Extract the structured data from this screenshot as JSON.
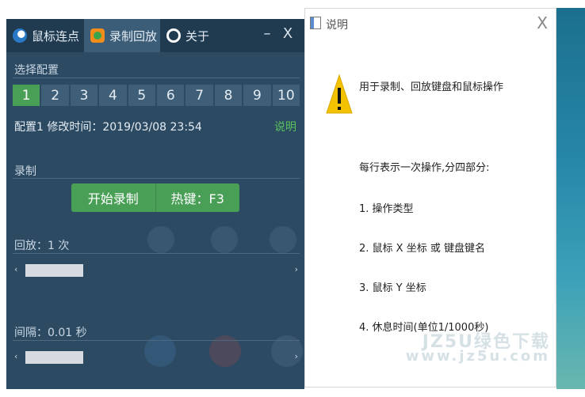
{
  "left_app": {
    "tabs": [
      {
        "label": "鼠标连点",
        "icon": "mouse-icon"
      },
      {
        "label": "录制回放",
        "icon": "record-icon"
      },
      {
        "label": "关于",
        "icon": "about-icon"
      }
    ],
    "minimize_label": "–",
    "close_label": "X",
    "config_section_label": "选择配置",
    "config_buttons": [
      "1",
      "2",
      "3",
      "4",
      "5",
      "6",
      "7",
      "8",
      "9",
      "10"
    ],
    "active_config": "1",
    "info_line": "配置1 修改时间：2019/03/08 23:54",
    "help_link": "说明",
    "record_section_label": "录制",
    "record_button_label": "开始录制",
    "hotkey_label": "热键：F3",
    "playback_label": "回放：1 次",
    "interval_label": "间隔：0.01 秒",
    "slider_left_arrow": "‹",
    "slider_right_arrow": "›",
    "playback_slider_level": 0.22,
    "interval_slider_level": 0.22
  },
  "dialog": {
    "title": "说明",
    "close_label": "X",
    "warning_icon": "warning-icon",
    "line1": "用于录制、回放键盘和鼠标操作",
    "line2": "每行表示一次操作,分四部分:",
    "item1": "1. 操作类型",
    "item2": "2. 鼠标 X 坐标 或 键盘键名",
    "item3": "3. 鼠标 Y 坐标",
    "item4": "4. 休息时间(单位1/1000秒)"
  },
  "watermark": {
    "line1": "JZ5U绿色下载",
    "line2": "www.jz5u.com"
  },
  "colors": {
    "window_bg": "#2d4a63",
    "tabbar_bg": "#203a50",
    "accent_green": "#4a9f56",
    "link_green": "#58c25e",
    "warning_yellow": "#f2c200"
  }
}
